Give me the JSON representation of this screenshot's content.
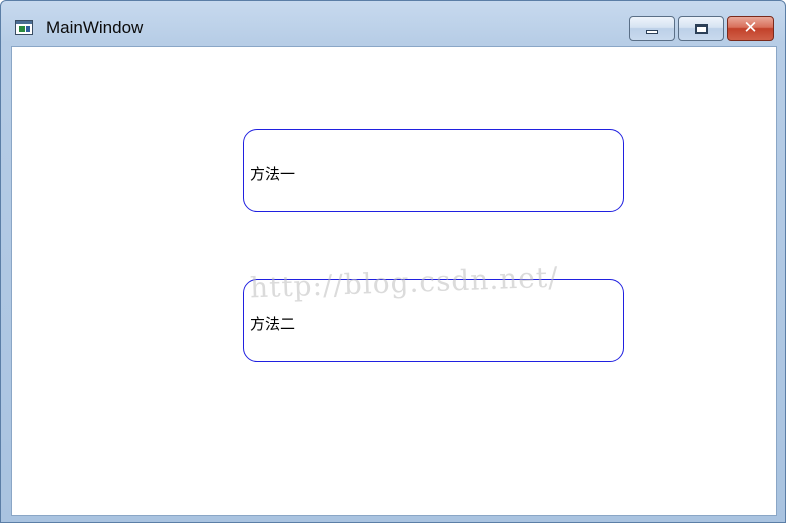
{
  "window": {
    "title": "MainWindow",
    "controls": {
      "minimize_icon": "minimize-icon",
      "maximize_icon": "maximize-icon",
      "close_icon": "close-icon",
      "close_glyph": "✕"
    }
  },
  "content": {
    "boxes": [
      {
        "label": "方法一"
      },
      {
        "label": "方法二"
      }
    ],
    "watermark": "http://blog.csdn.net/"
  },
  "colors": {
    "box_border": "#2020e0",
    "close_button": "#c2412a",
    "titlebar": "#b7cde6"
  }
}
